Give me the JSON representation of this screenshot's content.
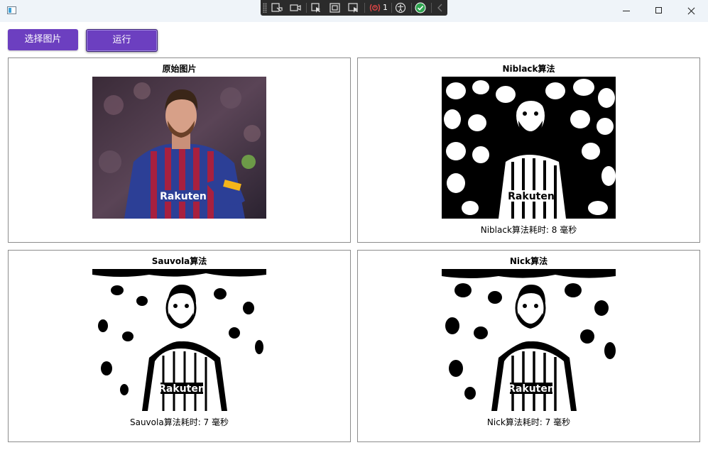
{
  "toolbar": {
    "select_label": "选择图片",
    "run_label": "运行"
  },
  "debug_toolbar": {
    "binding_error_count": "1"
  },
  "panels": {
    "original": {
      "title": "原始图片"
    },
    "niblack": {
      "title": "Niblack算法",
      "caption": "Niblack算法耗时: 8 毫秒"
    },
    "sauvola": {
      "title": "Sauvola算法",
      "caption": "Sauvola算法耗时: 7 毫秒"
    },
    "nick": {
      "title": "Nick算法",
      "caption": "Nick算法耗时: 7 毫秒"
    }
  },
  "colors": {
    "accent": "#6c3fc0",
    "titlebar": "#eff4f9",
    "debugbar": "#2b2b2b"
  }
}
